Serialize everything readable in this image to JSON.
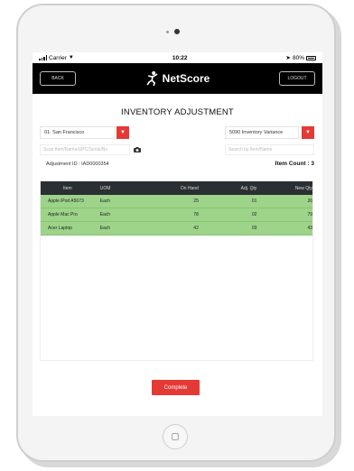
{
  "status_bar": {
    "carrier": "Carrier",
    "time": "10:22",
    "battery": "80%"
  },
  "header": {
    "back_label": "BACK",
    "logo_text": "NetScore",
    "logout_label": "LOGOUT"
  },
  "page": {
    "title": "INVENTORY ADJUSTMENT"
  },
  "filters": {
    "location": "01. San Francisco",
    "reason": "5090 Inventory Variance",
    "scan_placeholder": "Scan Item/Name/UPC/Serial/No",
    "search_placeholder": "Search by Item/Name"
  },
  "info": {
    "adjustment_id": "Adjustment ID : IAD0000354",
    "item_count": "Item Count : 3"
  },
  "table": {
    "headers": [
      "Item",
      "UOM",
      "On Hand",
      "Adj. Qty",
      "New Qty"
    ],
    "rows": [
      [
        "Apple iPod A5673",
        "Each",
        "25",
        "01",
        "26"
      ],
      [
        "Apple Mac Pro",
        "Each",
        "78",
        "02",
        "79"
      ],
      [
        "Acer Laptop",
        "Each",
        "42",
        "03",
        "43"
      ]
    ]
  },
  "footer": {
    "complete_label": "Complete"
  },
  "colors": {
    "accent_red": "#e53935",
    "row_green": "#9dd48a",
    "header_dark": "#2a2f33"
  }
}
